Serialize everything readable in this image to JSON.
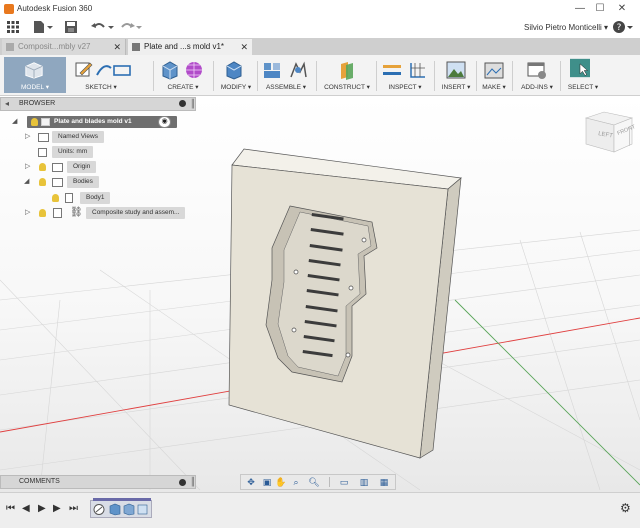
{
  "window": {
    "title": "Autodesk Fusion 360",
    "user": "Silvio Pietro Monticelli",
    "minimize": "—",
    "maximize": "☐",
    "close": "✕"
  },
  "tabs": [
    {
      "label": "Composit...mbly v27",
      "close": "✕"
    },
    {
      "label": "Plate and ...s mold v1*",
      "close": "✕"
    }
  ],
  "ribbon": {
    "workspace": "MODEL ▾",
    "groups": [
      {
        "label": "SKETCH ▾"
      },
      {
        "label": "CREATE ▾"
      },
      {
        "label": "MODIFY ▾"
      },
      {
        "label": "ASSEMBLE ▾"
      },
      {
        "label": "CONSTRUCT ▾"
      },
      {
        "label": "INSPECT ▾"
      },
      {
        "label": "INSERT ▾"
      },
      {
        "label": "MAKE ▾"
      },
      {
        "label": "ADD-INS ▾"
      },
      {
        "label": "SELECT ▾"
      }
    ]
  },
  "browser": {
    "title": "BROWSER",
    "root": "Plate and blades mold v1",
    "items": {
      "named_views": "Named Views",
      "units": "Units: mm",
      "origin": "Origin",
      "bodies": "Bodies",
      "body1": "Body1",
      "composite": "Composite study and assem..."
    }
  },
  "comments": {
    "title": "COMMENTS"
  },
  "viewcube": {
    "left": "LEFT",
    "front": "FRONT"
  },
  "colors": {
    "ribbon_bg": "#f3f3f3",
    "model_active": "#8fa7bf",
    "select_active": "#3f8f8a",
    "grid_x_axis": "#e04040",
    "grid_y_axis": "#5aa55a",
    "part_fill": "#e6e2d6"
  }
}
